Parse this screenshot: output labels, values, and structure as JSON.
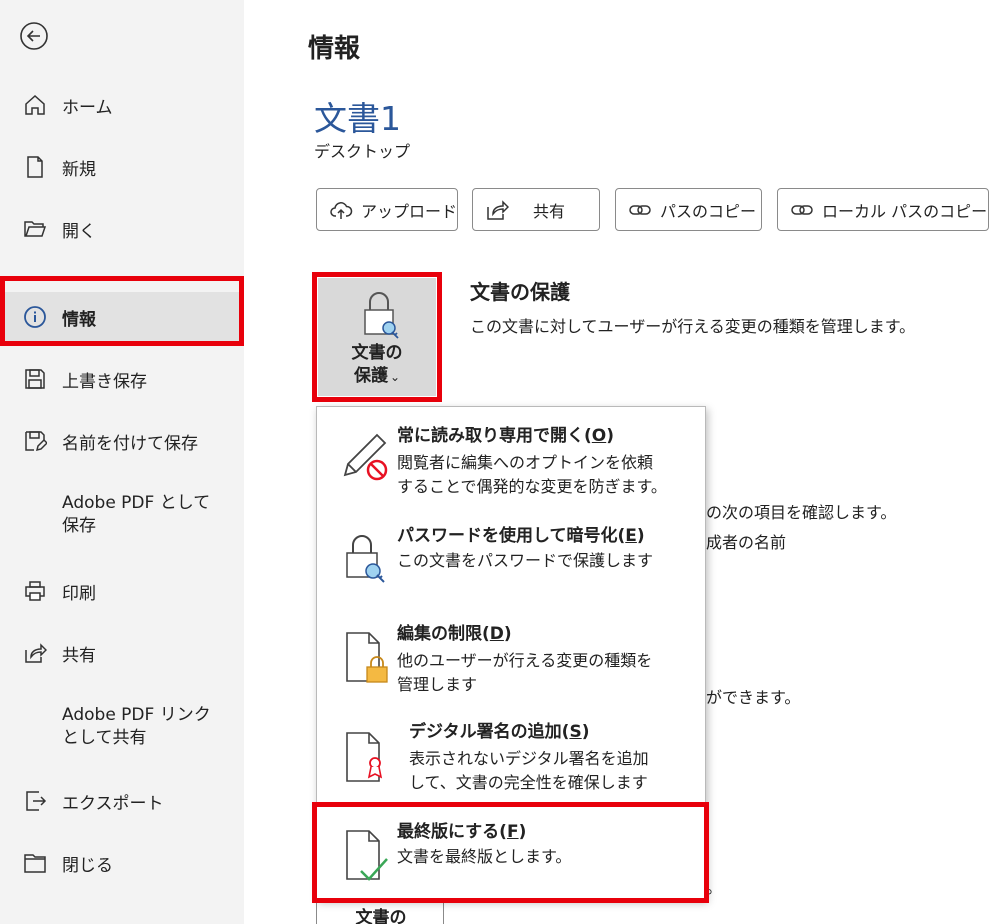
{
  "sidebar": {
    "items": [
      {
        "label": "ホーム"
      },
      {
        "label": "新規"
      },
      {
        "label": "開く"
      },
      {
        "label": "情報"
      },
      {
        "label": "上書き保存"
      },
      {
        "label": "名前を付けて保存"
      },
      {
        "label": "Adobe PDF として\n保存"
      },
      {
        "label": "印刷"
      },
      {
        "label": "共有"
      },
      {
        "label": "Adobe PDF リンク\nとして共有"
      },
      {
        "label": "エクスポート"
      },
      {
        "label": "閉じる"
      }
    ]
  },
  "main": {
    "page_title": "情報",
    "doc_title": "文書1",
    "doc_location": "デスクトップ",
    "toolbar": [
      {
        "label": "アップロード"
      },
      {
        "label": "共有"
      },
      {
        "label": "パスのコピー"
      },
      {
        "label": "ローカル パスのコピー"
      }
    ],
    "protect": {
      "tile_line1": "文書の",
      "tile_line2": "保護",
      "title": "文書の保護",
      "description": "この文書に対してユーザーが行える変更の種類を管理します。"
    },
    "background_text": {
      "line1": "の次の項目を確認します。",
      "line2": "成者の名前",
      "line3": "ができます。",
      "line4": "。",
      "bottom_tile": "文書の"
    }
  },
  "menu": {
    "items": [
      {
        "title": "常に読み取り専用で開く(",
        "key": "O",
        "title_end": ")",
        "description": "閲覧者に編集へのオプトインを依頼\nすることで偶発的な変更を防ぎます。"
      },
      {
        "title": "パスワードを使用して暗号化(",
        "key": "E",
        "title_end": ")",
        "description": "この文書をパスワードで保護します"
      },
      {
        "title": "編集の制限(",
        "key": "D",
        "title_end": ")",
        "description": "他のユーザーが行える変更の種類を\n管理します"
      },
      {
        "title": "デジタル署名の追加(",
        "key": "S",
        "title_end": ")",
        "description": "表示されないデジタル署名を追加\nして、文書の完全性を確保します"
      },
      {
        "title": "最終版にする(",
        "key": "F",
        "title_end": ")",
        "description": "文書を最終版とします。"
      }
    ]
  },
  "colors": {
    "accent": "#2b579a",
    "highlight_box": "#e8000b",
    "sidebar_bg": "#f3f3f3"
  }
}
